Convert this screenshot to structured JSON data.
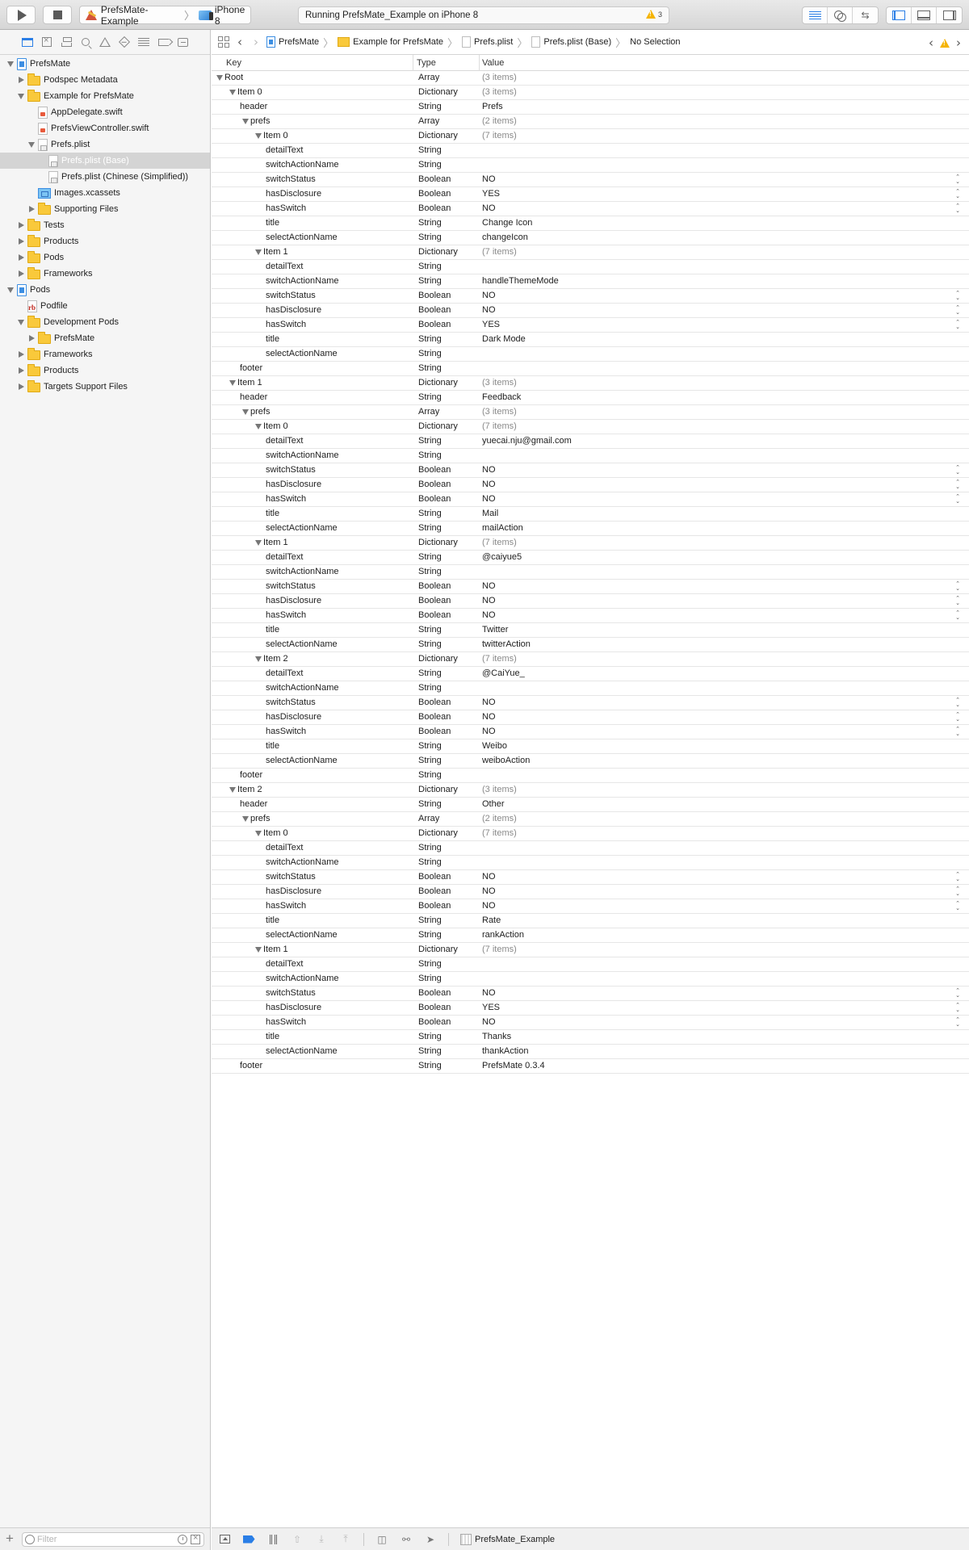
{
  "toolbar": {
    "run_label": "Run",
    "stop_label": "Stop",
    "scheme": "PrefsMate-Example",
    "device": "iPhone 8",
    "activity": "Running PrefsMate_Example on iPhone 8",
    "warning_count": "3"
  },
  "navigator": {
    "tabs": [
      "project-navigator",
      "source-control-navigator",
      "symbol-navigator",
      "find-navigator",
      "issue-navigator",
      "test-navigator",
      "debug-navigator",
      "breakpoint-navigator",
      "report-navigator"
    ],
    "tree": [
      {
        "label": "PrefsMate",
        "depth": 0,
        "disclosure": "open",
        "icon": "project"
      },
      {
        "label": "Podspec Metadata",
        "depth": 1,
        "disclosure": "closed",
        "icon": "folder"
      },
      {
        "label": "Example for PrefsMate",
        "depth": 1,
        "disclosure": "open",
        "icon": "folder"
      },
      {
        "label": "AppDelegate.swift",
        "depth": 2,
        "disclosure": "none",
        "icon": "swift"
      },
      {
        "label": "PrefsViewController.swift",
        "depth": 2,
        "disclosure": "none",
        "icon": "swift"
      },
      {
        "label": "Prefs.plist",
        "depth": 2,
        "disclosure": "open",
        "icon": "plist"
      },
      {
        "label": "Prefs.plist (Base)",
        "depth": 3,
        "disclosure": "none",
        "icon": "plist",
        "selected": true
      },
      {
        "label": "Prefs.plist (Chinese (Simplified))",
        "depth": 3,
        "disclosure": "none",
        "icon": "plist"
      },
      {
        "label": "Images.xcassets",
        "depth": 2,
        "disclosure": "none",
        "icon": "assets"
      },
      {
        "label": "Supporting Files",
        "depth": 2,
        "disclosure": "closed",
        "icon": "folder"
      },
      {
        "label": "Tests",
        "depth": 1,
        "disclosure": "closed",
        "icon": "folder"
      },
      {
        "label": "Products",
        "depth": 1,
        "disclosure": "closed",
        "icon": "folder"
      },
      {
        "label": "Pods",
        "depth": 1,
        "disclosure": "closed",
        "icon": "folder"
      },
      {
        "label": "Frameworks",
        "depth": 1,
        "disclosure": "closed",
        "icon": "folder"
      },
      {
        "label": "Pods",
        "depth": 0,
        "disclosure": "open",
        "icon": "project"
      },
      {
        "label": "Podfile",
        "depth": 1,
        "disclosure": "none",
        "icon": "rb"
      },
      {
        "label": "Development Pods",
        "depth": 1,
        "disclosure": "open",
        "icon": "folder"
      },
      {
        "label": "PrefsMate",
        "depth": 2,
        "disclosure": "closed",
        "icon": "folder"
      },
      {
        "label": "Frameworks",
        "depth": 1,
        "disclosure": "closed",
        "icon": "folder"
      },
      {
        "label": "Products",
        "depth": 1,
        "disclosure": "closed",
        "icon": "folder"
      },
      {
        "label": "Targets Support Files",
        "depth": 1,
        "disclosure": "closed",
        "icon": "folder"
      }
    ],
    "filter_placeholder": "Filter",
    "filter_value": ""
  },
  "jumpbar": {
    "crumbs": [
      {
        "label": "PrefsMate",
        "icon": "project"
      },
      {
        "label": "Example for PrefsMate",
        "icon": "folder"
      },
      {
        "label": "Prefs.plist",
        "icon": "plist"
      },
      {
        "label": "Prefs.plist (Base)",
        "icon": "plist"
      },
      {
        "label": "No Selection",
        "icon": ""
      }
    ]
  },
  "plist": {
    "columns": {
      "key": "Key",
      "type": "Type",
      "value": "Value"
    },
    "rows": [
      {
        "key": "Root",
        "depth": 0,
        "expand": true,
        "type": "Array",
        "value": "(3 items)",
        "count": true
      },
      {
        "key": "Item 0",
        "depth": 1,
        "expand": true,
        "type": "Dictionary",
        "value": "(3 items)",
        "count": true
      },
      {
        "key": "header",
        "depth": 2,
        "type": "String",
        "value": "Prefs"
      },
      {
        "key": "prefs",
        "depth": 2,
        "expand": true,
        "type": "Array",
        "value": "(2 items)",
        "count": true
      },
      {
        "key": "Item 0",
        "depth": 3,
        "expand": true,
        "type": "Dictionary",
        "value": "(7 items)",
        "count": true
      },
      {
        "key": "detailText",
        "depth": 4,
        "type": "String",
        "value": ""
      },
      {
        "key": "switchActionName",
        "depth": 4,
        "type": "String",
        "value": ""
      },
      {
        "key": "switchStatus",
        "depth": 4,
        "type": "Boolean",
        "value": "NO"
      },
      {
        "key": "hasDisclosure",
        "depth": 4,
        "type": "Boolean",
        "value": "YES"
      },
      {
        "key": "hasSwitch",
        "depth": 4,
        "type": "Boolean",
        "value": "NO"
      },
      {
        "key": "title",
        "depth": 4,
        "type": "String",
        "value": "Change Icon"
      },
      {
        "key": "selectActionName",
        "depth": 4,
        "type": "String",
        "value": "changeIcon"
      },
      {
        "key": "Item 1",
        "depth": 3,
        "expand": true,
        "type": "Dictionary",
        "value": "(7 items)",
        "count": true
      },
      {
        "key": "detailText",
        "depth": 4,
        "type": "String",
        "value": ""
      },
      {
        "key": "switchActionName",
        "depth": 4,
        "type": "String",
        "value": "handleThemeMode"
      },
      {
        "key": "switchStatus",
        "depth": 4,
        "type": "Boolean",
        "value": "NO"
      },
      {
        "key": "hasDisclosure",
        "depth": 4,
        "type": "Boolean",
        "value": "NO"
      },
      {
        "key": "hasSwitch",
        "depth": 4,
        "type": "Boolean",
        "value": "YES"
      },
      {
        "key": "title",
        "depth": 4,
        "type": "String",
        "value": "Dark Mode"
      },
      {
        "key": "selectActionName",
        "depth": 4,
        "type": "String",
        "value": ""
      },
      {
        "key": "footer",
        "depth": 2,
        "type": "String",
        "value": ""
      },
      {
        "key": "Item 1",
        "depth": 1,
        "expand": true,
        "type": "Dictionary",
        "value": "(3 items)",
        "count": true
      },
      {
        "key": "header",
        "depth": 2,
        "type": "String",
        "value": "Feedback"
      },
      {
        "key": "prefs",
        "depth": 2,
        "expand": true,
        "type": "Array",
        "value": "(3 items)",
        "count": true
      },
      {
        "key": "Item 0",
        "depth": 3,
        "expand": true,
        "type": "Dictionary",
        "value": "(7 items)",
        "count": true
      },
      {
        "key": "detailText",
        "depth": 4,
        "type": "String",
        "value": "yuecai.nju@gmail.com"
      },
      {
        "key": "switchActionName",
        "depth": 4,
        "type": "String",
        "value": ""
      },
      {
        "key": "switchStatus",
        "depth": 4,
        "type": "Boolean",
        "value": "NO"
      },
      {
        "key": "hasDisclosure",
        "depth": 4,
        "type": "Boolean",
        "value": "NO"
      },
      {
        "key": "hasSwitch",
        "depth": 4,
        "type": "Boolean",
        "value": "NO"
      },
      {
        "key": "title",
        "depth": 4,
        "type": "String",
        "value": "Mail"
      },
      {
        "key": "selectActionName",
        "depth": 4,
        "type": "String",
        "value": "mailAction"
      },
      {
        "key": "Item 1",
        "depth": 3,
        "expand": true,
        "type": "Dictionary",
        "value": "(7 items)",
        "count": true
      },
      {
        "key": "detailText",
        "depth": 4,
        "type": "String",
        "value": "@caiyue5"
      },
      {
        "key": "switchActionName",
        "depth": 4,
        "type": "String",
        "value": ""
      },
      {
        "key": "switchStatus",
        "depth": 4,
        "type": "Boolean",
        "value": "NO"
      },
      {
        "key": "hasDisclosure",
        "depth": 4,
        "type": "Boolean",
        "value": "NO"
      },
      {
        "key": "hasSwitch",
        "depth": 4,
        "type": "Boolean",
        "value": "NO"
      },
      {
        "key": "title",
        "depth": 4,
        "type": "String",
        "value": "Twitter"
      },
      {
        "key": "selectActionName",
        "depth": 4,
        "type": "String",
        "value": "twitterAction"
      },
      {
        "key": "Item 2",
        "depth": 3,
        "expand": true,
        "type": "Dictionary",
        "value": "(7 items)",
        "count": true
      },
      {
        "key": "detailText",
        "depth": 4,
        "type": "String",
        "value": "@CaiYue_"
      },
      {
        "key": "switchActionName",
        "depth": 4,
        "type": "String",
        "value": ""
      },
      {
        "key": "switchStatus",
        "depth": 4,
        "type": "Boolean",
        "value": "NO"
      },
      {
        "key": "hasDisclosure",
        "depth": 4,
        "type": "Boolean",
        "value": "NO"
      },
      {
        "key": "hasSwitch",
        "depth": 4,
        "type": "Boolean",
        "value": "NO"
      },
      {
        "key": "title",
        "depth": 4,
        "type": "String",
        "value": "Weibo"
      },
      {
        "key": "selectActionName",
        "depth": 4,
        "type": "String",
        "value": "weiboAction"
      },
      {
        "key": "footer",
        "depth": 2,
        "type": "String",
        "value": ""
      },
      {
        "key": "Item 2",
        "depth": 1,
        "expand": true,
        "type": "Dictionary",
        "value": "(3 items)",
        "count": true
      },
      {
        "key": "header",
        "depth": 2,
        "type": "String",
        "value": "Other"
      },
      {
        "key": "prefs",
        "depth": 2,
        "expand": true,
        "type": "Array",
        "value": "(2 items)",
        "count": true
      },
      {
        "key": "Item 0",
        "depth": 3,
        "expand": true,
        "type": "Dictionary",
        "value": "(7 items)",
        "count": true
      },
      {
        "key": "detailText",
        "depth": 4,
        "type": "String",
        "value": ""
      },
      {
        "key": "switchActionName",
        "depth": 4,
        "type": "String",
        "value": ""
      },
      {
        "key": "switchStatus",
        "depth": 4,
        "type": "Boolean",
        "value": "NO"
      },
      {
        "key": "hasDisclosure",
        "depth": 4,
        "type": "Boolean",
        "value": "NO"
      },
      {
        "key": "hasSwitch",
        "depth": 4,
        "type": "Boolean",
        "value": "NO"
      },
      {
        "key": "title",
        "depth": 4,
        "type": "String",
        "value": "Rate"
      },
      {
        "key": "selectActionName",
        "depth": 4,
        "type": "String",
        "value": "rankAction"
      },
      {
        "key": "Item 1",
        "depth": 3,
        "expand": true,
        "type": "Dictionary",
        "value": "(7 items)",
        "count": true
      },
      {
        "key": "detailText",
        "depth": 4,
        "type": "String",
        "value": ""
      },
      {
        "key": "switchActionName",
        "depth": 4,
        "type": "String",
        "value": ""
      },
      {
        "key": "switchStatus",
        "depth": 4,
        "type": "Boolean",
        "value": "NO"
      },
      {
        "key": "hasDisclosure",
        "depth": 4,
        "type": "Boolean",
        "value": "YES"
      },
      {
        "key": "hasSwitch",
        "depth": 4,
        "type": "Boolean",
        "value": "NO"
      },
      {
        "key": "title",
        "depth": 4,
        "type": "String",
        "value": "Thanks"
      },
      {
        "key": "selectActionName",
        "depth": 4,
        "type": "String",
        "value": "thankAction"
      },
      {
        "key": "footer",
        "depth": 2,
        "type": "String",
        "value": "PrefsMate 0.3.4"
      }
    ]
  },
  "debugbar": {
    "target": "PrefsMate_Example"
  },
  "colors": {
    "accent": "#2a7ee6",
    "warning": "#f5b400",
    "selection": "#d4d4d4",
    "count_text": "#8a8a8a"
  }
}
